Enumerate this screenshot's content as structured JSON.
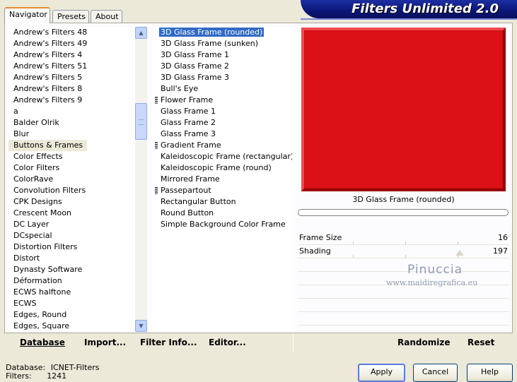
{
  "tabs": [
    "Navigator",
    "Presets",
    "About"
  ],
  "banner_title": "Filters Unlimited 2.0",
  "categories": [
    "Andrew's Filters 48",
    "Andrew's Filters 49",
    "Andrew's Filters 4",
    "Andrew's Filters 51",
    "Andrew's Filters 5",
    "Andrew's Filters 8",
    "Andrew's Filters 9",
    "a",
    "Balder Olrik",
    "Blur",
    "Buttons & Frames",
    "Color Effects",
    "Color Filters",
    "ColorRave",
    "Convolution Filters",
    "CPK Designs",
    "Crescent Moon",
    "DC Layer",
    "DCspecial",
    "Distortion Filters",
    "Distort",
    "Dynasty Software",
    "Déformation",
    "ECWS halftone",
    "ECWS",
    "Edges, Round",
    "Edges, Square"
  ],
  "selected_category": "Buttons & Frames",
  "filters": [
    {
      "name": "3D Glass Frame (rounded)",
      "marked": false
    },
    {
      "name": "3D Glass Frame (sunken)",
      "marked": false
    },
    {
      "name": "3D Glass Frame 1",
      "marked": false
    },
    {
      "name": "3D Glass Frame 2",
      "marked": false
    },
    {
      "name": "3D Glass Frame 3",
      "marked": false
    },
    {
      "name": "Bull's Eye",
      "marked": false
    },
    {
      "name": "Flower Frame",
      "marked": true
    },
    {
      "name": "Glass Frame 1",
      "marked": false
    },
    {
      "name": "Glass Frame 2",
      "marked": false
    },
    {
      "name": "Glass Frame 3",
      "marked": false
    },
    {
      "name": "Gradient Frame",
      "marked": true
    },
    {
      "name": "Kaleidoscopic Frame (rectangular)",
      "marked": false
    },
    {
      "name": "Kaleidoscopic Frame (round)",
      "marked": false
    },
    {
      "name": "Mirrored Frame",
      "marked": false
    },
    {
      "name": "Passepartout",
      "marked": true
    },
    {
      "name": "Rectangular Button",
      "marked": false
    },
    {
      "name": "Round Button",
      "marked": false
    },
    {
      "name": "Simple Background Color Frame",
      "marked": false
    }
  ],
  "selected_filter": "3D Glass Frame (rounded)",
  "preview": {
    "color": "#dc1118",
    "filter_name": "3D Glass Frame (rounded)"
  },
  "params": [
    {
      "label": "Frame Size",
      "value": "16"
    },
    {
      "label": "Shading",
      "value": "197"
    }
  ],
  "watermark": {
    "name": "Pinuccia",
    "url": "www.maidiregrafica.eu"
  },
  "toolbar": {
    "database": "Database",
    "import": "Import...",
    "filter_info": "Filter Info...",
    "editor": "Editor...",
    "randomize": "Randomize",
    "reset": "Reset"
  },
  "status": {
    "database_label": "Database:",
    "database_value": "ICNET-Filters",
    "filters_label": "Filters:",
    "filters_value": "1241"
  },
  "buttons": {
    "apply": "Apply",
    "cancel": "Cancel",
    "help": "Help"
  }
}
